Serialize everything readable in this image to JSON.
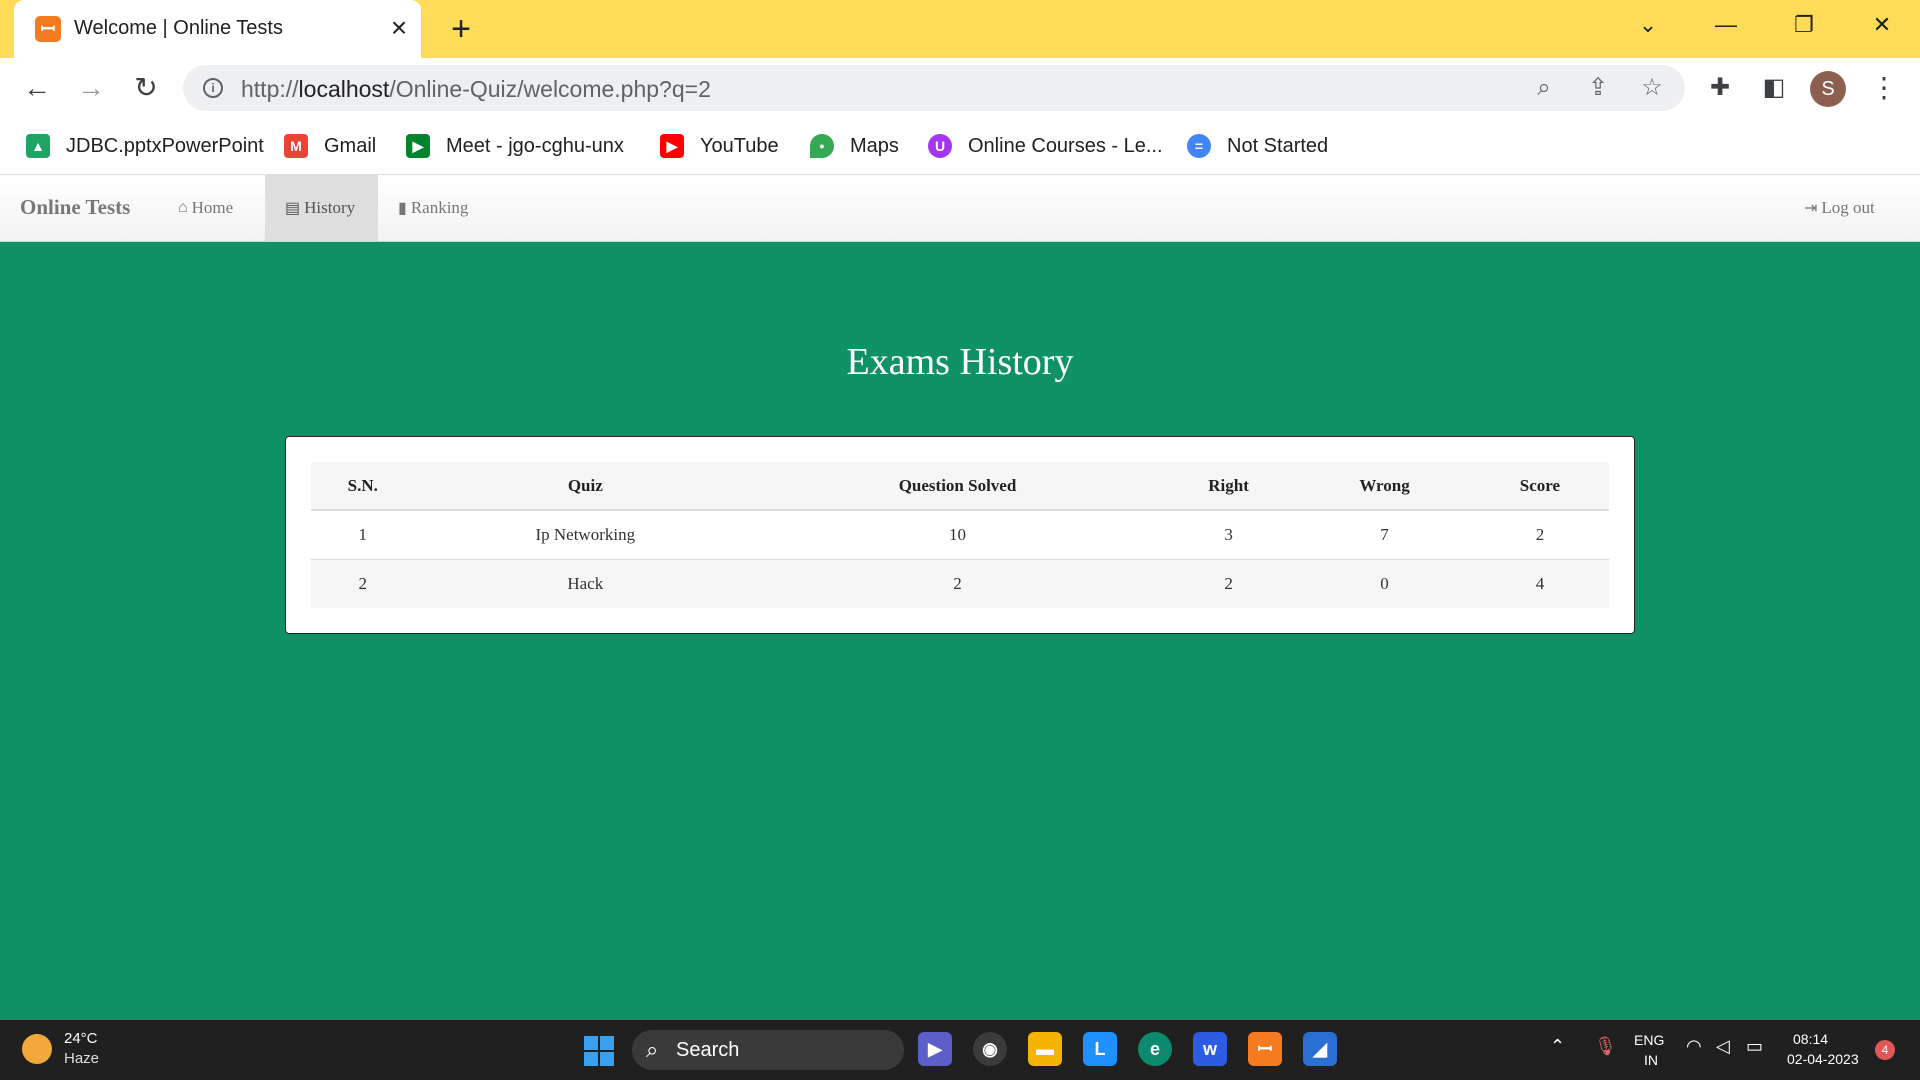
{
  "browser": {
    "tab_title": "Welcome | Online Tests",
    "url_scheme": "http://",
    "url_host": "localhost",
    "url_path": "/Online-Quiz/welcome.php?q=2",
    "profile_initial": "S"
  },
  "bookmarks": [
    {
      "label": "JDBC.pptxPowerPoint",
      "icon": "google-drive-icon",
      "color": "#1fa463"
    },
    {
      "label": "Gmail",
      "icon": "gmail-icon",
      "color": "#ea4335"
    },
    {
      "label": "Meet - jgo-cghu-unx",
      "icon": "google-meet-icon",
      "color": "#00832d"
    },
    {
      "label": "YouTube",
      "icon": "youtube-icon",
      "color": "#ff0000"
    },
    {
      "label": "Maps",
      "icon": "maps-icon",
      "color": "#34a853"
    },
    {
      "label": "Online Courses - Le...",
      "icon": "courses-icon",
      "color": "#a435f0"
    },
    {
      "label": "Not Started",
      "icon": "doc-icon",
      "color": "#4285f4"
    }
  ],
  "app_nav": {
    "brand": "Online Tests",
    "home": "Home",
    "history": "History",
    "ranking": "Ranking",
    "logout": "Log out"
  },
  "main": {
    "title": "Exams History",
    "columns": [
      "S.N.",
      "Quiz",
      "Question Solved",
      "Right",
      "Wrong",
      "Score"
    ],
    "rows": [
      [
        "1",
        "Ip Networking",
        "10",
        "3",
        "7",
        "2"
      ],
      [
        "2",
        "Hack",
        "2",
        "2",
        "0",
        "4"
      ]
    ]
  },
  "taskbar": {
    "temperature": "24°C",
    "weather": "Haze",
    "search_label": "Search",
    "lang_top": "ENG",
    "lang_bottom": "IN",
    "time": "08:14",
    "date": "02-04-2023",
    "notifications": "4",
    "accent": "#3aa0f0"
  },
  "colors": {
    "page_background": "#0e9265",
    "titlebar": "#fedc5a"
  }
}
